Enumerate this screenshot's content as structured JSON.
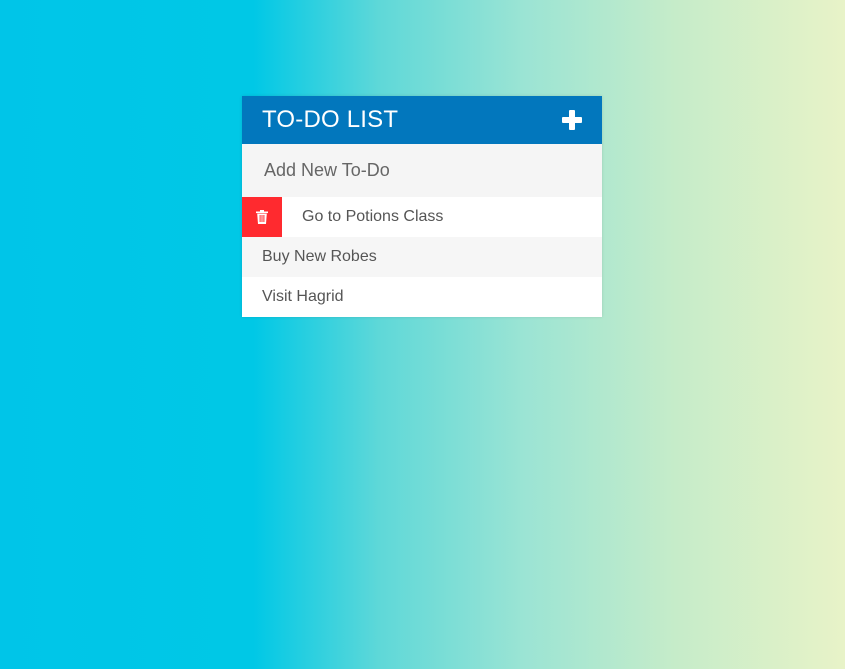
{
  "header": {
    "title": "TO-DO LIST",
    "add_icon": "plus-icon"
  },
  "new_todo": {
    "placeholder": "Add New To-Do"
  },
  "todos": [
    {
      "text": "Go to Potions Class",
      "hovered": true
    },
    {
      "text": "Buy New Robes",
      "hovered": false
    },
    {
      "text": "Visit Hagrid",
      "hovered": false
    }
  ],
  "delete_icon": "trash-icon",
  "colors": {
    "header": "#0277bd",
    "delete": "#ff2a2f",
    "text": "#555555",
    "background_start": "#00c5e8",
    "background_end": "#e8f3c8"
  }
}
